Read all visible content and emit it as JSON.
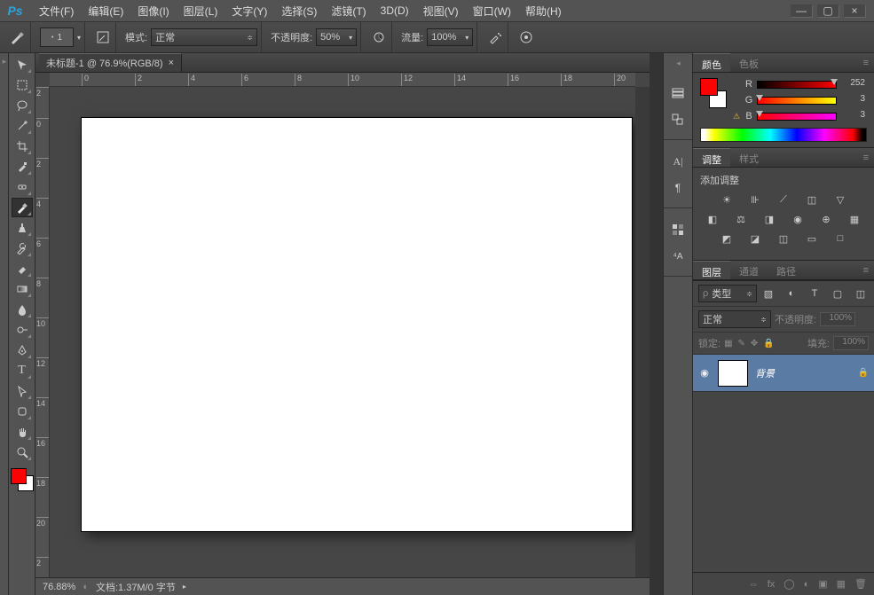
{
  "app_logo": "Ps",
  "menu": {
    "items": [
      "文件(F)",
      "编辑(E)",
      "图像(I)",
      "图层(L)",
      "文字(Y)",
      "选择(S)",
      "滤镜(T)",
      "3D(D)",
      "视图(V)",
      "窗口(W)",
      "帮助(H)"
    ]
  },
  "window_controls": {
    "min": "—",
    "max": "▢",
    "close": "×"
  },
  "options": {
    "brush_size": "1",
    "mode_label": "模式:",
    "mode_value": "正常",
    "opacity_label": "不透明度:",
    "opacity_value": "50%",
    "flow_label": "流量:",
    "flow_value": "100%"
  },
  "document": {
    "tab_title": "未标题-1 @ 76.9%(RGB/8)",
    "tab_close": "×",
    "ruler_h": [
      "0",
      "2",
      "4",
      "6",
      "8",
      "10",
      "12",
      "14",
      "16",
      "18",
      "20"
    ],
    "ruler_v": [
      "2",
      "0",
      "2",
      "4",
      "6",
      "8",
      "10",
      "12",
      "14",
      "16",
      "18",
      "20",
      "2"
    ],
    "zoom_status": "76.88%",
    "doc_info": "文档:1.37M/0 字节"
  },
  "color_panel": {
    "tabs": [
      "颜色",
      "色板"
    ],
    "r_label": "R",
    "r_value": "252",
    "g_label": "G",
    "g_value": "3",
    "b_label": "B",
    "b_value": "3",
    "fg_hex": "#fc0303",
    "bg_hex": "#ffffff"
  },
  "adjust_panel": {
    "tabs": [
      "调整",
      "样式"
    ],
    "heading": "添加调整"
  },
  "layers_panel": {
    "tabs": [
      "图层",
      "通道",
      "路径"
    ],
    "kind_filter": "类型",
    "blend_mode": "正常",
    "opacity_label": "不透明度:",
    "opacity_value": "100%",
    "lock_label": "锁定:",
    "fill_label": "填充:",
    "fill_value": "100%",
    "layers": [
      {
        "name": "背景",
        "visible": true,
        "locked": true
      }
    ]
  }
}
